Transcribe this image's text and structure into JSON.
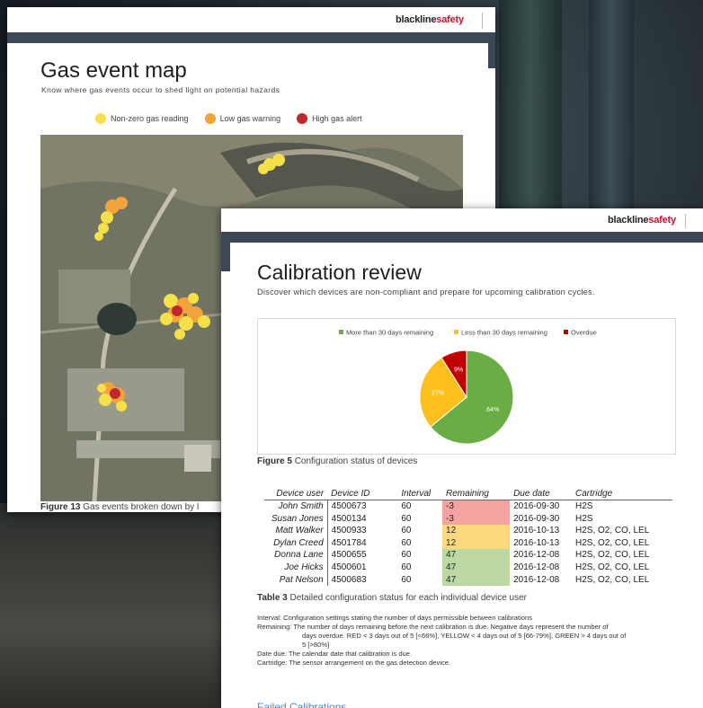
{
  "brand": {
    "black": "blackline",
    "red": "safety"
  },
  "page1": {
    "title": "Gas event map",
    "subtitle": "Know where gas events occur to shed light on potential hazards",
    "legend": [
      {
        "label": "Non-zero gas reading",
        "color": "#f5e04a"
      },
      {
        "label": "Low gas warning",
        "color": "#f2a33a"
      },
      {
        "label": "High gas alert",
        "color": "#c0282d"
      }
    ],
    "caption_bold": "Figure 13",
    "caption_text": "Gas events broken down by l"
  },
  "page2": {
    "title": "Calibration review",
    "subtitle": "Discover which devices are non-compliant and prepare for upcoming calibration cycles.",
    "caption_bold": "Figure 5",
    "caption_text": "Configuration status of devices",
    "table_caption_bold": "Table 3",
    "table_caption_text": "Detailed configuration status for each individual device user",
    "table": {
      "headers": [
        "Device user",
        "Device ID",
        "Interval",
        "Remaining",
        "Due date",
        "Cartridge"
      ],
      "rows": [
        [
          "John Smith",
          "4500673",
          "60",
          "-3",
          "2016-09-30",
          "H2S"
        ],
        [
          "Susan Jones",
          "4500134",
          "60",
          "-3",
          "2016-09-30",
          "H2S"
        ],
        [
          "Matt Walker",
          "4500933",
          "60",
          "12",
          "2016-10-13",
          "H2S, O2, CO, LEL"
        ],
        [
          "Dylan Creed",
          "4501784",
          "60",
          "12",
          "2016-10-13",
          "H2S, O2, CO, LEL"
        ],
        [
          "Donna Lane",
          "4500655",
          "60",
          "47",
          "2016-12-08",
          "H2S, O2, CO, LEL"
        ],
        [
          "Joe Hicks",
          "4500601",
          "60",
          "47",
          "2016-12-08",
          "H2S, O2, CO, LEL"
        ],
        [
          "Pat Nelson",
          "4500683",
          "60",
          "47",
          "2016-12-08",
          "H2S, O2, CO, LEL"
        ]
      ],
      "remaining_colors": [
        "#f4a3a0",
        "#f4a3a0",
        "#fcd87f",
        "#fcd87f",
        "#bcd9a3",
        "#bcd9a3",
        "#bcd9a3"
      ]
    },
    "notes": [
      "Interval: Configuration settings stating the number of days permissible between calibrations",
      "Remaining: The number of days remaining before the next calibration is due. Negative days represent  the number of",
      "days overdue.  RED < 3 days out of 5 [<66%], YELLOW  < 4 days out of 5 [66-79%], GREEN > 4 days out of",
      "5 [>80%]",
      "Date due: The calendar date that calibration is due.",
      "Cartridge:  The sensor arrangement  on the gas detection device."
    ],
    "next_heading": "Failed Calibrations"
  },
  "chart_data": {
    "type": "pie",
    "title": "",
    "categories": [
      "More than 30 days remaining",
      "Less than 30 days remaining",
      "Overdue"
    ],
    "values": [
      64,
      27,
      9
    ],
    "labels": [
      "64%",
      "27%",
      "9%"
    ],
    "colors": [
      "#6aad45",
      "#fcbf1c",
      "#c00000"
    ],
    "legend_position": "top"
  }
}
